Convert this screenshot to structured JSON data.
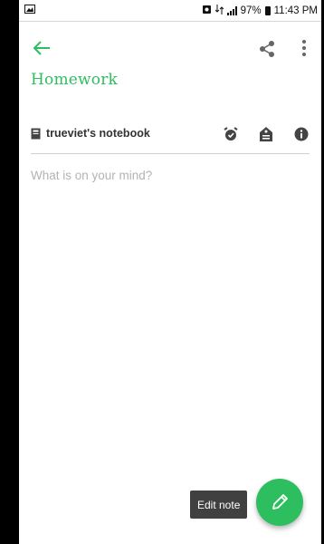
{
  "status_bar": {
    "battery": "97%",
    "time": "11:43 PM"
  },
  "note": {
    "title": "Homework",
    "notebook": "trueviet's notebook",
    "body_placeholder": "What is on your mind?"
  },
  "fab": {
    "tooltip": "Edit note"
  },
  "icons": {
    "back": "arrow-left",
    "share": "share",
    "overflow": "more-vert",
    "notebook": "book",
    "reminder": "alarm",
    "tag": "tag",
    "info": "info",
    "edit": "pencil"
  },
  "colors": {
    "accent": "#2dbe60",
    "tooltip_bg": "#404040"
  }
}
